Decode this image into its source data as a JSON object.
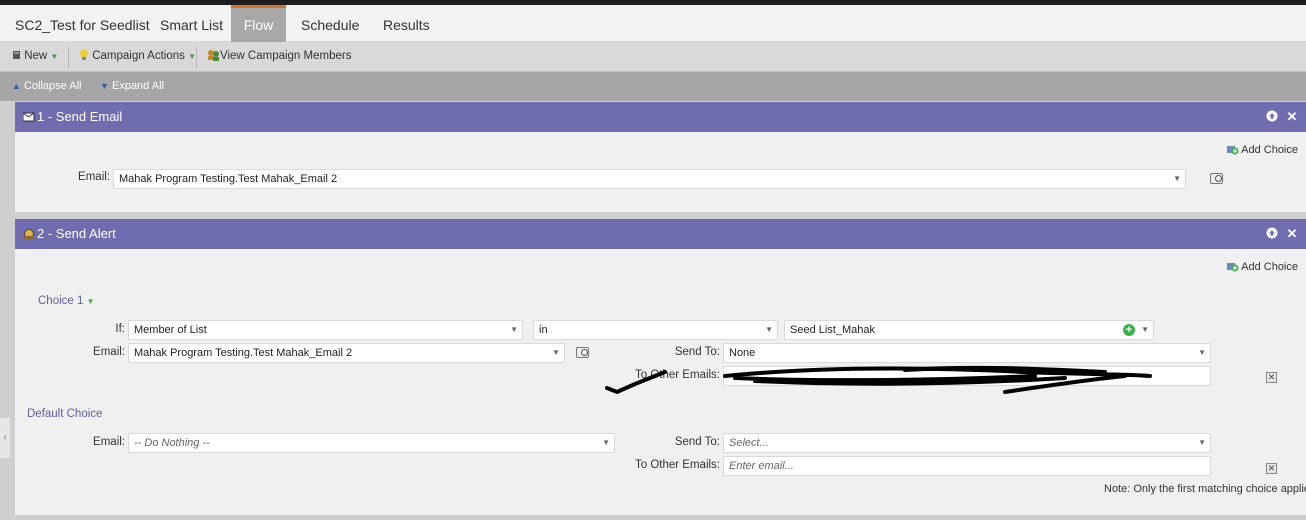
{
  "tabs": [
    {
      "label": "SC2_Test for Seedlist"
    },
    {
      "label": "Smart List"
    },
    {
      "label": "Flow"
    },
    {
      "label": "Schedule"
    },
    {
      "label": "Results"
    }
  ],
  "active_tab": "Flow",
  "toolbar": {
    "new_label": "New",
    "campaign_actions_label": "Campaign Actions",
    "view_members_label": "View Campaign Members"
  },
  "collapsebar": {
    "collapse_label": "Collapse All",
    "expand_label": "Expand All"
  },
  "steps": [
    {
      "title": "1 - Send Email",
      "add_choice_label": "Add Choice",
      "email_label": "Email:",
      "email_value": "Mahak Program Testing.Test Mahak_Email 2"
    },
    {
      "title": "2 - Send Alert",
      "add_choice_label": "Add Choice",
      "choice1": {
        "label": "Choice 1",
        "if_label": "If:",
        "condition": "Member of List",
        "operator": "in",
        "list_value": "Seed List_Mahak",
        "email_label": "Email:",
        "email_value": "Mahak Program Testing.Test Mahak_Email 2",
        "send_to_label": "Send To:",
        "send_to_value": "None",
        "other_emails_label": "To Other Emails:"
      },
      "default_choice": {
        "label": "Default Choice",
        "email_label": "Email:",
        "email_value": "-- Do Nothing --",
        "send_to_label": "Send To:",
        "send_to_placeholder": "Select...",
        "other_emails_label": "To Other Emails:",
        "other_emails_placeholder": "Enter email..."
      },
      "note": "Note: Only the first matching choice applies"
    }
  ],
  "colors": {
    "step_header": "#6f6db0",
    "active_tab_accent": "#d8742a",
    "choice_link": "#5b5fa8"
  }
}
